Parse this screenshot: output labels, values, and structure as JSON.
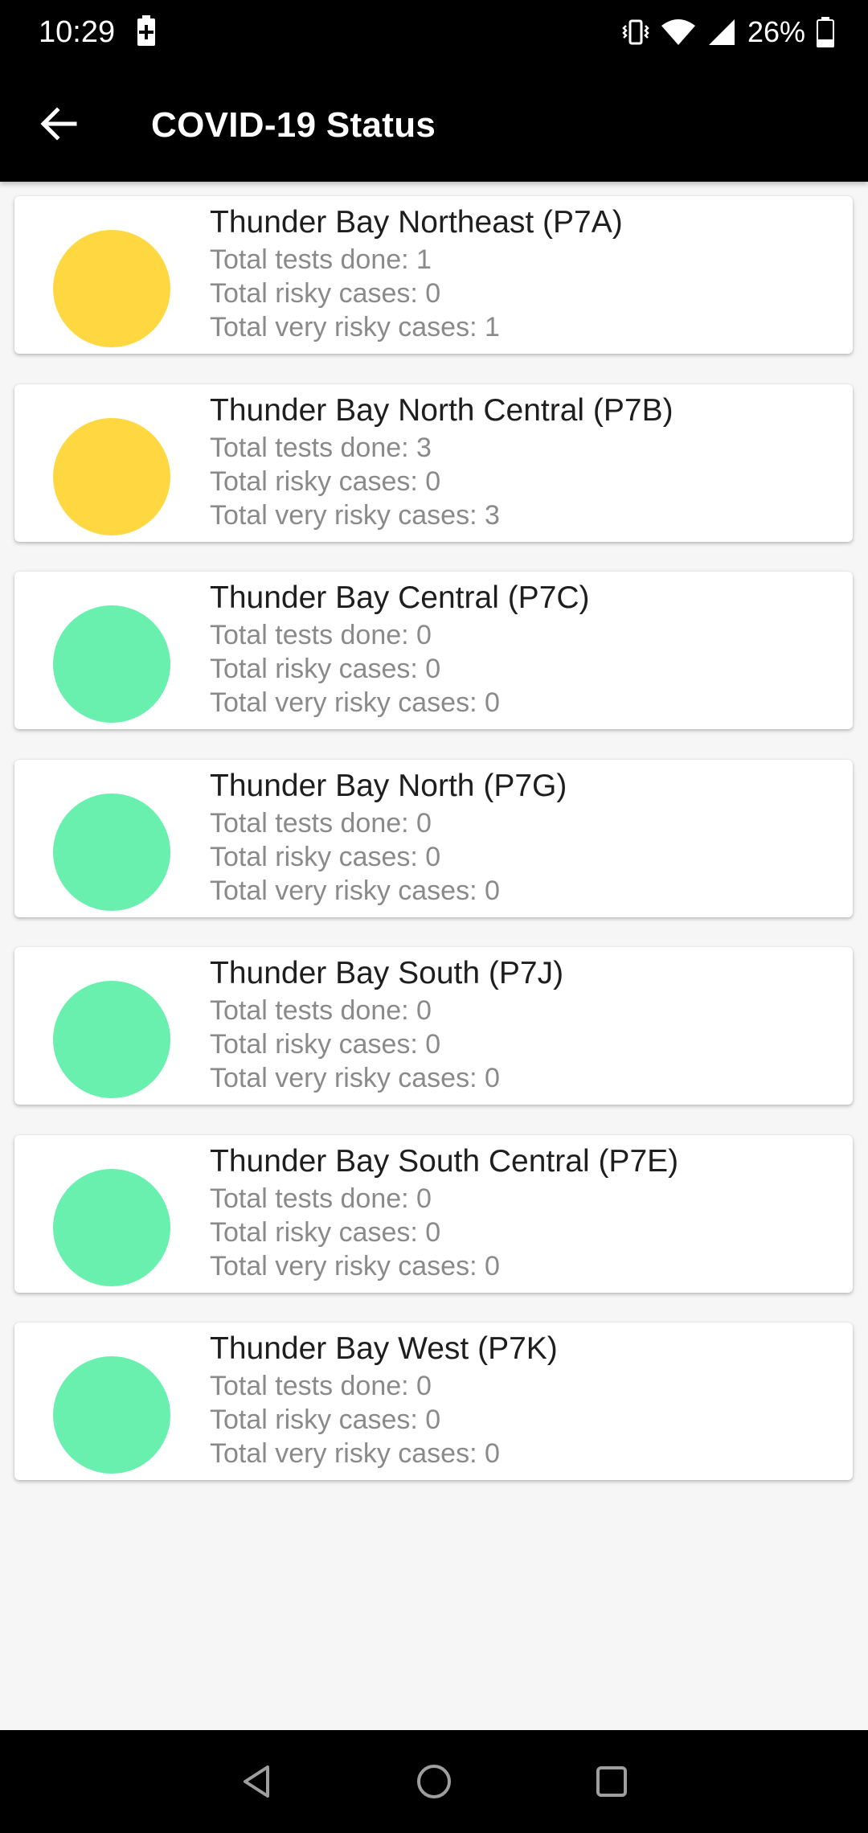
{
  "status_bar": {
    "time": "10:29",
    "battery_percent": "26%",
    "icons": [
      "battery-charging-icon",
      "vibrate-icon",
      "wifi-icon",
      "signal-icon",
      "battery-icon"
    ]
  },
  "app_bar": {
    "title": "COVID-19 Status",
    "back_icon": "arrow-left-icon"
  },
  "colors": {
    "yellow": "#FFD740",
    "green": "#69F0AE",
    "app_bar_bg": "#000000",
    "page_bg": "#F6F6F6"
  },
  "regions": [
    {
      "name": "Thunder Bay Northeast (P7A)",
      "status_color": "#FFD740",
      "tests": "Total tests done: 1",
      "risky": "Total risky cases: 0",
      "very_risky": "Total very risky cases: 1"
    },
    {
      "name": "Thunder Bay North Central (P7B)",
      "status_color": "#FFD740",
      "tests": "Total tests done: 3",
      "risky": "Total risky cases: 0",
      "very_risky": "Total very risky cases: 3"
    },
    {
      "name": "Thunder Bay Central (P7C)",
      "status_color": "#69F0AE",
      "tests": "Total tests done: 0",
      "risky": "Total risky cases: 0",
      "very_risky": "Total very risky cases: 0"
    },
    {
      "name": "Thunder Bay North (P7G)",
      "status_color": "#69F0AE",
      "tests": "Total tests done: 0",
      "risky": "Total risky cases: 0",
      "very_risky": "Total very risky cases: 0"
    },
    {
      "name": "Thunder Bay South (P7J)",
      "status_color": "#69F0AE",
      "tests": "Total tests done: 0",
      "risky": "Total risky cases: 0",
      "very_risky": "Total very risky cases: 0"
    },
    {
      "name": "Thunder Bay South Central (P7E)",
      "status_color": "#69F0AE",
      "tests": "Total tests done: 0",
      "risky": "Total risky cases: 0",
      "very_risky": "Total very risky cases: 0"
    },
    {
      "name": "Thunder Bay West (P7K)",
      "status_color": "#69F0AE",
      "tests": "Total tests done: 0",
      "risky": "Total risky cases: 0",
      "very_risky": "Total very risky cases: 0"
    }
  ],
  "nav_bar": {
    "buttons": [
      "back-triangle-icon",
      "home-circle-icon",
      "recents-square-icon"
    ]
  }
}
